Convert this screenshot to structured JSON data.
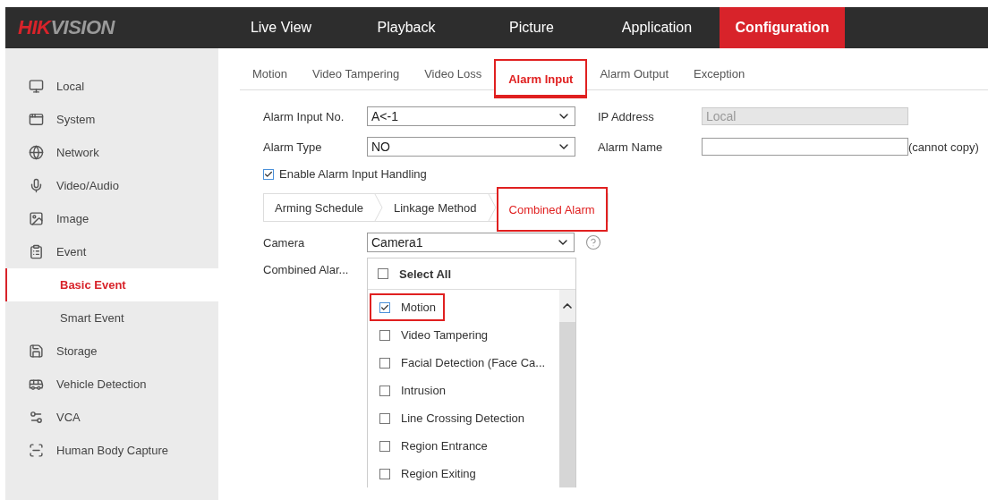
{
  "header": {
    "logo": {
      "brand": "HIK",
      "rest": "VISION"
    },
    "nav": [
      {
        "label": "Live View",
        "selected": false
      },
      {
        "label": "Playback",
        "selected": false
      },
      {
        "label": "Picture",
        "selected": false
      },
      {
        "label": "Application",
        "selected": false
      },
      {
        "label": "Configuration",
        "selected": true
      }
    ]
  },
  "sidebar": {
    "items": [
      {
        "label": "Local",
        "selected": false
      },
      {
        "label": "System",
        "selected": false
      },
      {
        "label": "Network",
        "selected": false
      },
      {
        "label": "Video/Audio",
        "selected": false
      },
      {
        "label": "Image",
        "selected": false
      },
      {
        "label": "Event",
        "selected": false,
        "children": [
          {
            "label": "Basic Event",
            "selected": true
          },
          {
            "label": "Smart Event",
            "selected": false
          }
        ]
      },
      {
        "label": "Storage",
        "selected": false
      },
      {
        "label": "Vehicle Detection",
        "selected": false
      },
      {
        "label": "VCA",
        "selected": false
      },
      {
        "label": "Human Body Capture",
        "selected": false
      }
    ]
  },
  "tabs": [
    {
      "label": "Motion",
      "selected": false,
      "highlighted": false
    },
    {
      "label": "Video Tampering",
      "selected": false,
      "highlighted": false
    },
    {
      "label": "Video Loss",
      "selected": false,
      "highlighted": false
    },
    {
      "label": "Alarm Input",
      "selected": true,
      "highlighted": true
    },
    {
      "label": "Alarm Output",
      "selected": false,
      "highlighted": false
    },
    {
      "label": "Exception",
      "selected": false,
      "highlighted": false
    }
  ],
  "form": {
    "alarm_input_no": {
      "label": "Alarm Input No.",
      "value": "A<-1"
    },
    "ip_address": {
      "label": "IP Address",
      "value": "Local",
      "disabled": true
    },
    "alarm_type": {
      "label": "Alarm Type",
      "value": "NO"
    },
    "alarm_name": {
      "label": "Alarm Name",
      "note": "(cannot copy)"
    },
    "enable_handling": {
      "label": "Enable Alarm Input Handling",
      "checked": true
    }
  },
  "steps": [
    {
      "label": "Arming Schedule",
      "selected": false,
      "highlighted": false
    },
    {
      "label": "Linkage Method",
      "selected": false,
      "highlighted": false
    },
    {
      "label": "Combined Alarm",
      "selected": true,
      "highlighted": true
    }
  ],
  "camera": {
    "label": "Camera",
    "value": "Camera1"
  },
  "combined_alarm": {
    "label": "Combined Alar...",
    "select_all": {
      "label": "Select All",
      "checked": false
    },
    "items": [
      {
        "label": "Motion",
        "checked": true,
        "highlighted": true
      },
      {
        "label": "Video Tampering",
        "checked": false,
        "highlighted": false
      },
      {
        "label": "Facial Detection (Face Ca...",
        "checked": false,
        "highlighted": false
      },
      {
        "label": "Intrusion",
        "checked": false,
        "highlighted": false
      },
      {
        "label": "Line Crossing Detection",
        "checked": false,
        "highlighted": false
      },
      {
        "label": "Region Entrance",
        "checked": false,
        "highlighted": false
      },
      {
        "label": "Region Exiting",
        "checked": false,
        "highlighted": false
      }
    ]
  }
}
